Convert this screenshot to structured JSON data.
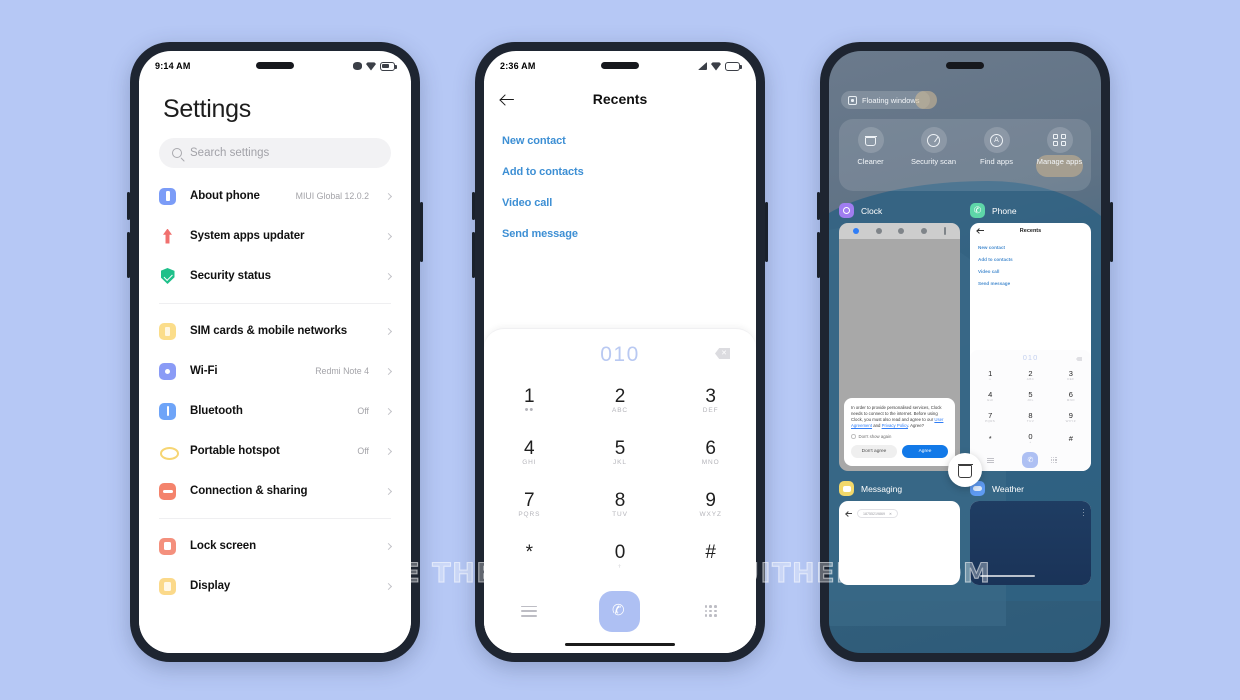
{
  "page": {
    "background_color": "#b6c8f5",
    "watermark": "FOR MORE THEMES VISIT - MIUITHEMEZ.COM"
  },
  "phone1": {
    "statusbar": {
      "time": "9:14 AM",
      "icons": [
        "signal-icon",
        "wifi-icon",
        "battery-icon"
      ]
    },
    "title": "Settings",
    "search": {
      "placeholder": "Search settings",
      "icon": "search-icon"
    },
    "groups": [
      {
        "items": [
          {
            "label": "About phone",
            "value": "MIUI Global 12.0.2",
            "icon": "about-phone-icon",
            "color": "#7b9cf7"
          },
          {
            "label": "System apps updater",
            "value": "",
            "icon": "updater-arrow-icon",
            "color": "#f0706e"
          },
          {
            "label": "Security status",
            "value": "",
            "icon": "shield-check-icon",
            "color": "#1fc08a"
          }
        ]
      },
      {
        "items": [
          {
            "label": "SIM cards & mobile networks",
            "value": "",
            "icon": "sim-card-icon",
            "color": "#fbdd8a"
          },
          {
            "label": "Wi-Fi",
            "value": "Redmi Note 4",
            "icon": "wifi-icon",
            "color": "#8a9bf6"
          },
          {
            "label": "Bluetooth",
            "value": "Off",
            "icon": "bluetooth-icon",
            "color": "#6ea4f8"
          },
          {
            "label": "Portable hotspot",
            "value": "Off",
            "icon": "hotspot-icon",
            "color": "#f6d573"
          },
          {
            "label": "Connection & sharing",
            "value": "",
            "icon": "connection-sharing-icon",
            "color": "#f4836c"
          }
        ]
      },
      {
        "items": [
          {
            "label": "Lock screen",
            "value": "",
            "icon": "lock-screen-icon",
            "color": "#f4907d"
          },
          {
            "label": "Display",
            "value": "",
            "icon": "display-icon",
            "color": "#fbd98a"
          }
        ]
      }
    ]
  },
  "phone2": {
    "statusbar": {
      "time": "2:36 AM",
      "icons": [
        "signal-icon",
        "wifi-icon",
        "battery-icon"
      ]
    },
    "header": {
      "title": "Recents",
      "back_icon": "back-arrow-icon"
    },
    "menu_items": [
      "New contact",
      "Add to contacts",
      "Video call",
      "Send message"
    ],
    "link_color": "#3d8fd4",
    "dialpad": {
      "number": "010",
      "backspace_icon": "backspace-icon",
      "keys": [
        {
          "digit": "1",
          "letters": "••"
        },
        {
          "digit": "2",
          "letters": "ABC"
        },
        {
          "digit": "3",
          "letters": "DEF"
        },
        {
          "digit": "4",
          "letters": "GHI"
        },
        {
          "digit": "5",
          "letters": "JKL"
        },
        {
          "digit": "6",
          "letters": "MNO"
        },
        {
          "digit": "7",
          "letters": "PQRS"
        },
        {
          "digit": "8",
          "letters": "TUV"
        },
        {
          "digit": "9",
          "letters": "WXYZ"
        },
        {
          "digit": "*",
          "letters": ""
        },
        {
          "digit": "0",
          "letters": "+"
        },
        {
          "digit": "#",
          "letters": ""
        }
      ],
      "actions": {
        "menu_icon": "list-lines-icon",
        "call_icon": "phone-call-icon",
        "call_button_color": "#aec0f3",
        "keypad_icon": "keypad-grid-icon"
      }
    }
  },
  "phone3": {
    "floating_chip": {
      "label": "Floating windows",
      "icon": "floating-window-icon"
    },
    "quick_actions": [
      {
        "label": "Cleaner",
        "icon": "trash-icon"
      },
      {
        "label": "Security scan",
        "icon": "scan-icon"
      },
      {
        "label": "Find apps",
        "icon": "find-apps-icon"
      },
      {
        "label": "Manage apps",
        "icon": "manage-apps-icon"
      }
    ],
    "cards": [
      {
        "app": "Clock",
        "icon": "clock-app-icon",
        "color": "#a07df0"
      },
      {
        "app": "Phone",
        "icon": "phone-app-icon",
        "color": "#5ed6a8"
      },
      {
        "app": "Messaging",
        "icon": "messaging-app-icon",
        "color": "#f2d86a"
      },
      {
        "app": "Weather",
        "icon": "weather-app-icon",
        "color": "#5e9af2"
      }
    ],
    "clock_dialog": {
      "body": "In order to provide personalised services, Clock needs to connect to the internet. Before using Clock, you must also read and agree to our ",
      "link1": "User Agreement",
      "mid": " and ",
      "link2": "Privacy Policy",
      "tail": ". Agree?",
      "checkbox_label": "Don't show again",
      "decline_label": "Don't agree",
      "accept_label": "Agree",
      "accept_color": "#1279e8"
    },
    "phone_card": {
      "title": "Recents",
      "menu_items": [
        "New contact",
        "Add to contacts",
        "Video call",
        "Send message"
      ],
      "number": "010",
      "keys": [
        {
          "digit": "1",
          "letters": "••"
        },
        {
          "digit": "2",
          "letters": "ABC"
        },
        {
          "digit": "3",
          "letters": "DEF"
        },
        {
          "digit": "4",
          "letters": "GHI"
        },
        {
          "digit": "5",
          "letters": "JKL"
        },
        {
          "digit": "6",
          "letters": "MNO"
        },
        {
          "digit": "7",
          "letters": "PQRS"
        },
        {
          "digit": "8",
          "letters": "TUV"
        },
        {
          "digit": "9",
          "letters": "WXYZ"
        },
        {
          "digit": "*",
          "letters": ""
        },
        {
          "digit": "0",
          "letters": "+"
        },
        {
          "digit": "#",
          "letters": ""
        }
      ]
    },
    "messaging_card": {
      "recipient": "18755219869"
    },
    "trash_fab_icon": "trash-icon"
  }
}
